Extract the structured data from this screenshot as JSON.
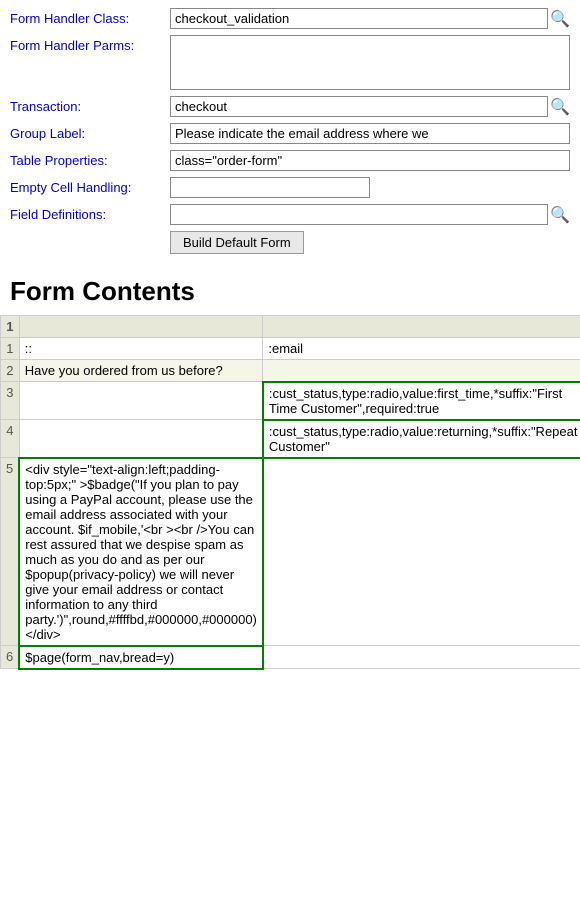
{
  "formConfig": {
    "labels": {
      "formHandlerClass": "Form Handler Class:",
      "formHandlerParms": "Form Handler Parms:",
      "transaction": "Transaction:",
      "groupLabel": "Group Label:",
      "tableProperties": "Table Properties:",
      "emptyCellHandling": "Empty Cell Handling:",
      "fieldDefinitions": "Field Definitions:"
    },
    "values": {
      "formHandlerClass": "checkout_validation",
      "formHandlerParms": "",
      "transaction": "checkout",
      "groupLabel": "Please indicate the email address where we",
      "tableProperties": "class=\"order-form\"",
      "emptyCellHandling": "",
      "fieldDefinitions": ""
    },
    "buildButtonLabel": "Build Default Form"
  },
  "formContents": {
    "title": "Form Contents",
    "headerCol": "1",
    "rows": [
      {
        "num": "1",
        "colA": "::",
        "colB": ":email",
        "greenA": false,
        "greenB": false
      },
      {
        "num": "2",
        "colA": "Have you ordered from us before?",
        "colB": "",
        "greenA": false,
        "greenB": false
      },
      {
        "num": "3",
        "colA": "&nbsp;",
        "colB": ":cust_status,type:radio,value:first_time,*suffix:\"First Time Customer\",required:true",
        "greenA": false,
        "greenB": true
      },
      {
        "num": "4",
        "colA": "&nbsp;",
        "colB": ":cust_status,type:radio,value:returning,*suffix:\"Repeat Customer\"",
        "greenA": false,
        "greenB": true
      },
      {
        "num": "5",
        "colA": "<div style=\"text-align:left;padding-top:5px;\" >$badge(\"If you plan to pay using a PayPal account, please use the email address associated with your account. $if_mobile,'<br ><br />You can rest assured that we despise spam as much as you do and as per our $popup(privacy-policy) we will never give your email address or contact information to any third party.')\",round,#ffffbd,#000000,#000000)</div>",
        "colB": "",
        "greenA": true,
        "greenB": false
      },
      {
        "num": "6",
        "colA": "$page(form_nav,bread=y)",
        "colB": "",
        "greenA": true,
        "greenB": false
      }
    ]
  }
}
